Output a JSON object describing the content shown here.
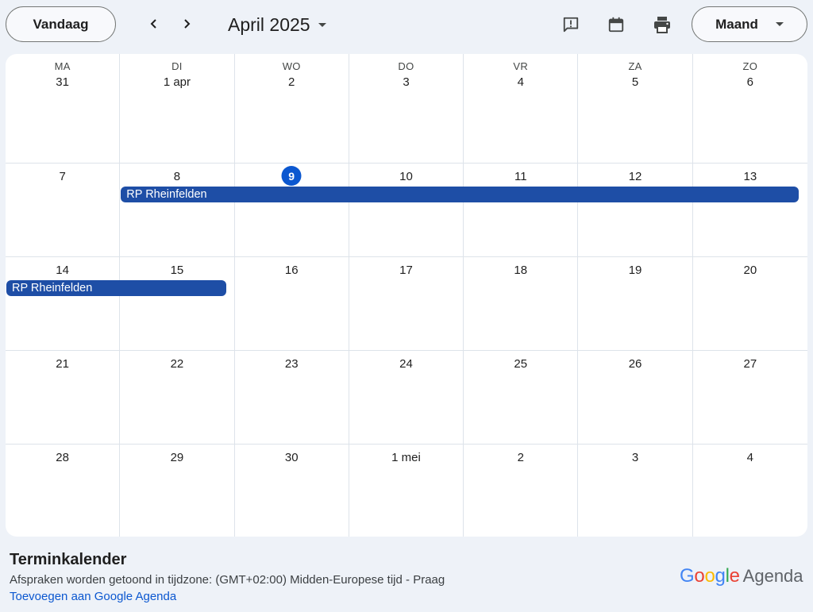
{
  "toolbar": {
    "today_label": "Vandaag",
    "month_title": "April 2025",
    "view_label": "Maand",
    "icons": [
      "chevron-left-icon",
      "chevron-right-icon",
      "caret-down-icon",
      "feedback-icon",
      "calendar-icon",
      "print-icon"
    ]
  },
  "weekdays": [
    "MA",
    "DI",
    "WO",
    "DO",
    "VR",
    "ZA",
    "ZO"
  ],
  "weeks": [
    [
      "31",
      "1 apr",
      "2",
      "3",
      "4",
      "5",
      "6"
    ],
    [
      "7",
      "8",
      "9",
      "10",
      "11",
      "12",
      "13"
    ],
    [
      "14",
      "15",
      "16",
      "17",
      "18",
      "19",
      "20"
    ],
    [
      "21",
      "22",
      "23",
      "24",
      "25",
      "26",
      "27"
    ],
    [
      "28",
      "29",
      "30",
      "1 mei",
      "2",
      "3",
      "4"
    ]
  ],
  "today": "9",
  "events": [
    {
      "title": "RP Rheinfelden",
      "start": "8",
      "end": "13"
    },
    {
      "title": "RP Rheinfelden",
      "start": "14",
      "end": "15"
    }
  ],
  "event_color": "#1e4ea6",
  "today_color": "#0b57d0",
  "footer": {
    "calendar_name": "Terminkalender",
    "timezone_text": "Afspraken worden getoond in tijdzone: (GMT+02:00) Midden-Europese tijd - Praag",
    "add_link": "Toevoegen aan Google Agenda"
  },
  "brand": {
    "google": [
      "G",
      "o",
      "o",
      "g",
      "l",
      "e"
    ],
    "google_colors": [
      "#4285F4",
      "#EA4335",
      "#FBBC05",
      "#4285F4",
      "#34A853",
      "#EA4335"
    ],
    "product": "Agenda"
  }
}
